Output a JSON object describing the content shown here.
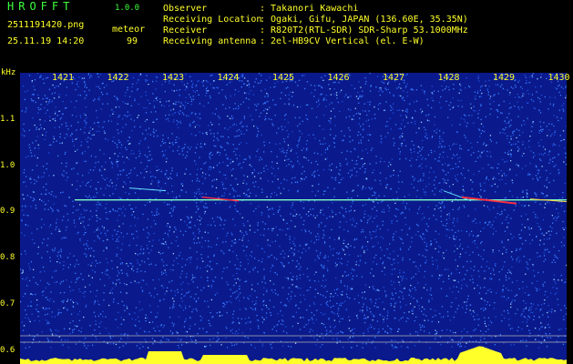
{
  "app": {
    "title": "HROFFT",
    "version": "1.0.0"
  },
  "file": "2511191420.png",
  "datetime": "25.11.19 14:20",
  "meteor": {
    "label": "meteor",
    "count": "99"
  },
  "info": [
    {
      "key": "Observer",
      "value": ": Takanori Kawachi"
    },
    {
      "key": "Receiving Location",
      "value": ": Ogaki, Gifu, JAPAN (136.60E, 35.35N)"
    },
    {
      "key": "Receiver",
      "value": ": R820T2(RTL-SDR) SDR-Sharp 53.1000MHz"
    },
    {
      "key": "Receiving antenna",
      "value": ": 2el-HB9CV Vertical (el. E-W)"
    }
  ],
  "chart_data": {
    "type": "heatmap",
    "ylabel": "kHz",
    "ylim": [
      0.57,
      1.2
    ],
    "y_ticks": [
      "1.1",
      "1.0",
      "0.9",
      "0.8",
      "0.7",
      "0.6"
    ],
    "x_ticks": [
      "1421",
      "1422",
      "1423",
      "1424",
      "1425",
      "1426",
      "1427",
      "1428",
      "1429",
      "1430"
    ],
    "colors": {
      "background": "#0a1a8c",
      "noise": "#3a7bff",
      "carrier": "#7fffc0",
      "echo": "#ff3040",
      "axis_text": "#ffff2a",
      "grid": "#b0b0b0"
    },
    "carrier_khz": 0.925
  }
}
